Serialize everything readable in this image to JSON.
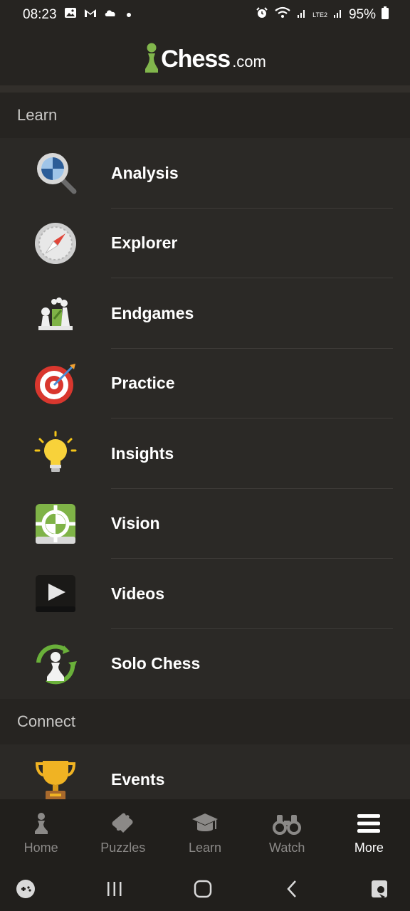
{
  "status_bar": {
    "time": "08:23",
    "battery": "95%",
    "network_label": "LTE2"
  },
  "header": {
    "logo_main": "Chess",
    "logo_suffix": ".com"
  },
  "sections": {
    "learn": {
      "title": "Learn",
      "items": [
        {
          "label": "Analysis",
          "icon": "analysis-magnifier-icon"
        },
        {
          "label": "Explorer",
          "icon": "compass-icon"
        },
        {
          "label": "Endgames",
          "icon": "endgame-pieces-icon"
        },
        {
          "label": "Practice",
          "icon": "target-icon"
        },
        {
          "label": "Insights",
          "icon": "lightbulb-icon"
        },
        {
          "label": "Vision",
          "icon": "crosshair-icon"
        },
        {
          "label": "Videos",
          "icon": "play-icon"
        },
        {
          "label": "Solo Chess",
          "icon": "solo-pawn-icon"
        }
      ]
    },
    "connect": {
      "title": "Connect",
      "items": [
        {
          "label": "Events",
          "icon": "trophy-icon"
        }
      ]
    }
  },
  "bottom_nav": {
    "items": [
      {
        "label": "Home",
        "icon": "pawn-icon",
        "active": false
      },
      {
        "label": "Puzzles",
        "icon": "puzzle-icon",
        "active": false
      },
      {
        "label": "Learn",
        "icon": "graduation-cap-icon",
        "active": false
      },
      {
        "label": "Watch",
        "icon": "binoculars-icon",
        "active": false
      },
      {
        "label": "More",
        "icon": "hamburger-menu-icon",
        "active": true
      }
    ]
  },
  "colors": {
    "background": "#2b2926",
    "header_bg": "#262421",
    "brand_green": "#81b64c",
    "inactive_nav": "#8b8987"
  }
}
